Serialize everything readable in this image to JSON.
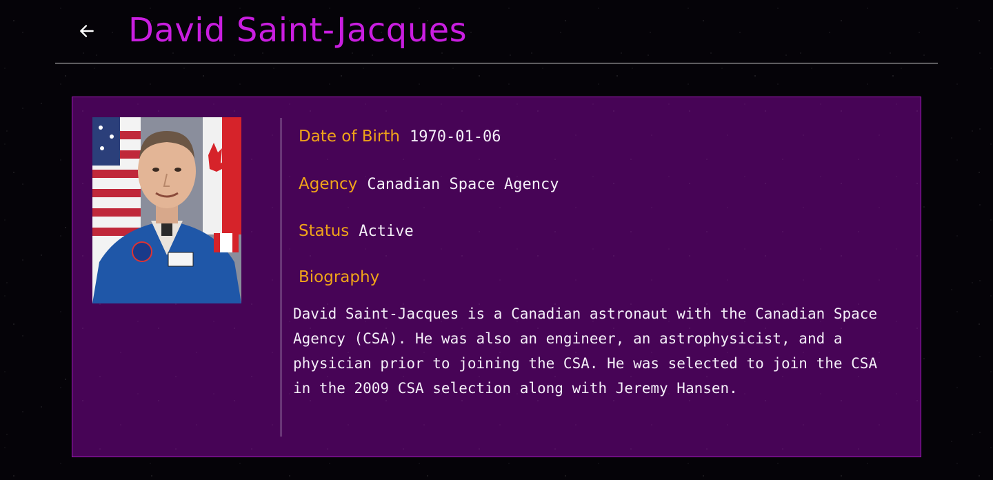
{
  "header": {
    "title": "David Saint-Jacques",
    "back_icon": "arrow-left-icon"
  },
  "profile": {
    "photo_alt": "David Saint-Jacques",
    "fields": [
      {
        "label": "Date of Birth",
        "value": "1970-01-06"
      },
      {
        "label": "Agency",
        "value": "Canadian Space Agency"
      },
      {
        "label": "Status",
        "value": "Active"
      }
    ],
    "biography_label": "Biography",
    "biography": "David Saint-Jacques is a Canadian astronaut with the Canadian Space Agency (CSA). He was also an engineer, an astrophysicist, and a physician prior to joining the CSA. He was selected to join the CSA in the 2009 CSA selection along with Jeremy Hansen."
  },
  "colors": {
    "title": "#c91ee0",
    "label": "#f0a419",
    "card_bg": "#470456",
    "card_border": "#a51cc0",
    "text": "#f4eef8"
  }
}
